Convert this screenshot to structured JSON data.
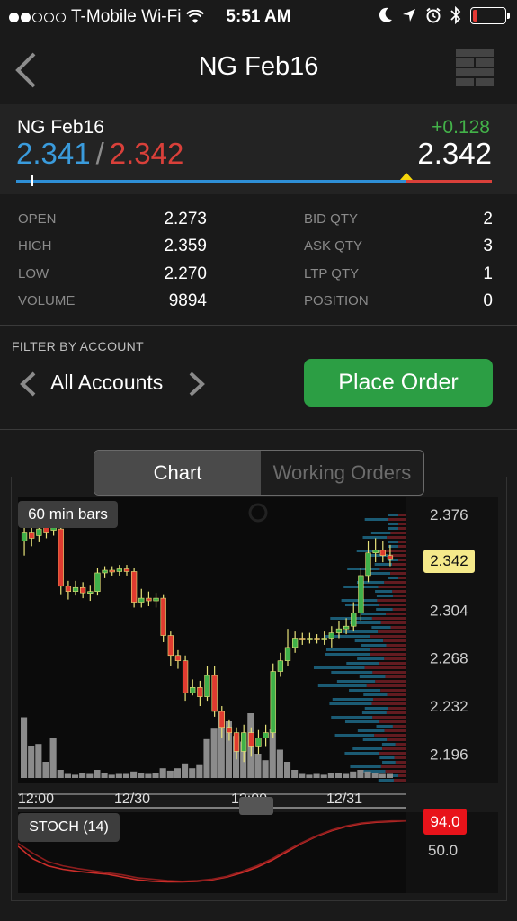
{
  "status_bar": {
    "carrier": "T-Mobile Wi-Fi",
    "time": "5:51 AM",
    "signal_dots_filled": 2,
    "signal_dots_total": 5,
    "battery_level": 0.15
  },
  "nav": {
    "title": "NG Feb16",
    "back_icon": "chevron-left-icon",
    "menu_icon": "grid-menu-icon"
  },
  "quote": {
    "symbol": "NG Feb16",
    "bid": "2.341",
    "separator": "/",
    "ask": "2.342",
    "change": "+0.128",
    "last": "2.342",
    "range_position": 0.82,
    "bid_color": "#3a9bdc",
    "ask_color": "#d9403a",
    "change_color": "#43b249"
  },
  "stats": {
    "left": [
      {
        "label": "OPEN",
        "value": "2.273"
      },
      {
        "label": "HIGH",
        "value": "2.359"
      },
      {
        "label": "LOW",
        "value": "2.270"
      },
      {
        "label": "VOLUME",
        "value": "9894"
      }
    ],
    "right": [
      {
        "label": "BID QTY",
        "value": "2"
      },
      {
        "label": "ASK QTY",
        "value": "3"
      },
      {
        "label": "LTP QTY",
        "value": "1"
      },
      {
        "label": "POSITION",
        "value": "0"
      }
    ]
  },
  "filter": {
    "label": "FILTER BY ACCOUNT",
    "account": "All Accounts",
    "place_order_label": "Place Order",
    "place_order_color": "#2c9e44"
  },
  "tabs": [
    {
      "label": "Chart",
      "active": true
    },
    {
      "label": "Working Orders",
      "active": false
    }
  ],
  "chart_data": {
    "type": "candlestick",
    "bars_label": "60 min bars",
    "y_ticks": [
      "2.376",
      "2.304",
      "2.268",
      "2.232",
      "2.196"
    ],
    "ylim": [
      2.178,
      2.386
    ],
    "current_price": "2.342",
    "x_ticks": [
      "12:00",
      "12/30",
      "12:00",
      "12/31"
    ],
    "candles": [
      {
        "o": 2.356,
        "c": 2.362,
        "h": 2.366,
        "l": 2.345
      },
      {
        "o": 2.362,
        "c": 2.358,
        "h": 2.368,
        "l": 2.352
      },
      {
        "o": 2.36,
        "c": 2.365,
        "h": 2.37,
        "l": 2.355
      },
      {
        "o": 2.366,
        "c": 2.362,
        "h": 2.371,
        "l": 2.358
      },
      {
        "o": 2.364,
        "c": 2.366,
        "h": 2.372,
        "l": 2.36
      },
      {
        "o": 2.365,
        "c": 2.322,
        "h": 2.368,
        "l": 2.316
      },
      {
        "o": 2.322,
        "c": 2.318,
        "h": 2.326,
        "l": 2.312
      },
      {
        "o": 2.318,
        "c": 2.321,
        "h": 2.326,
        "l": 2.315
      },
      {
        "o": 2.321,
        "c": 2.317,
        "h": 2.325,
        "l": 2.313
      },
      {
        "o": 2.317,
        "c": 2.318,
        "h": 2.323,
        "l": 2.311
      },
      {
        "o": 2.318,
        "c": 2.332,
        "h": 2.336,
        "l": 2.315
      },
      {
        "o": 2.332,
        "c": 2.334,
        "h": 2.337,
        "l": 2.328
      },
      {
        "o": 2.334,
        "c": 2.333,
        "h": 2.337,
        "l": 2.33
      },
      {
        "o": 2.333,
        "c": 2.335,
        "h": 2.338,
        "l": 2.33
      },
      {
        "o": 2.335,
        "c": 2.333,
        "h": 2.338,
        "l": 2.33
      },
      {
        "o": 2.333,
        "c": 2.31,
        "h": 2.336,
        "l": 2.306
      },
      {
        "o": 2.31,
        "c": 2.313,
        "h": 2.32,
        "l": 2.306
      },
      {
        "o": 2.313,
        "c": 2.311,
        "h": 2.318,
        "l": 2.307
      },
      {
        "o": 2.311,
        "c": 2.313,
        "h": 2.317,
        "l": 2.306
      },
      {
        "o": 2.313,
        "c": 2.285,
        "h": 2.316,
        "l": 2.28
      },
      {
        "o": 2.285,
        "c": 2.27,
        "h": 2.288,
        "l": 2.262
      },
      {
        "o": 2.27,
        "c": 2.266,
        "h": 2.274,
        "l": 2.26
      },
      {
        "o": 2.266,
        "c": 2.242,
        "h": 2.27,
        "l": 2.236
      },
      {
        "o": 2.242,
        "c": 2.246,
        "h": 2.252,
        "l": 2.24
      },
      {
        "o": 2.246,
        "c": 2.239,
        "h": 2.251,
        "l": 2.232
      },
      {
        "o": 2.239,
        "c": 2.255,
        "h": 2.262,
        "l": 2.236
      },
      {
        "o": 2.255,
        "c": 2.228,
        "h": 2.262,
        "l": 2.224
      },
      {
        "o": 2.228,
        "c": 2.216,
        "h": 2.232,
        "l": 2.208
      },
      {
        "o": 2.216,
        "c": 2.212,
        "h": 2.222,
        "l": 2.206
      },
      {
        "o": 2.212,
        "c": 2.198,
        "h": 2.216,
        "l": 2.192
      },
      {
        "o": 2.198,
        "c": 2.212,
        "h": 2.218,
        "l": 2.19
      },
      {
        "o": 2.212,
        "c": 2.202,
        "h": 2.216,
        "l": 2.194
      },
      {
        "o": 2.202,
        "c": 2.208,
        "h": 2.214,
        "l": 2.196
      },
      {
        "o": 2.208,
        "c": 2.212,
        "h": 2.218,
        "l": 2.202
      },
      {
        "o": 2.212,
        "c": 2.258,
        "h": 2.264,
        "l": 2.208
      },
      {
        "o": 2.258,
        "c": 2.266,
        "h": 2.272,
        "l": 2.254
      },
      {
        "o": 2.266,
        "c": 2.276,
        "h": 2.29,
        "l": 2.262
      },
      {
        "o": 2.276,
        "c": 2.283,
        "h": 2.288,
        "l": 2.272
      },
      {
        "o": 2.283,
        "c": 2.282,
        "h": 2.287,
        "l": 2.278
      },
      {
        "o": 2.282,
        "c": 2.283,
        "h": 2.287,
        "l": 2.279
      },
      {
        "o": 2.283,
        "c": 2.282,
        "h": 2.286,
        "l": 2.279
      },
      {
        "o": 2.282,
        "c": 2.283,
        "h": 2.288,
        "l": 2.278
      },
      {
        "o": 2.283,
        "c": 2.287,
        "h": 2.292,
        "l": 2.276
      },
      {
        "o": 2.287,
        "c": 2.29,
        "h": 2.296,
        "l": 2.283
      },
      {
        "o": 2.29,
        "c": 2.292,
        "h": 2.298,
        "l": 2.286
      },
      {
        "o": 2.292,
        "c": 2.302,
        "h": 2.31,
        "l": 2.288
      },
      {
        "o": 2.302,
        "c": 2.33,
        "h": 2.336,
        "l": 2.296
      },
      {
        "o": 2.33,
        "c": 2.347,
        "h": 2.356,
        "l": 2.325
      },
      {
        "o": 2.347,
        "c": 2.349,
        "h": 2.358,
        "l": 2.34
      },
      {
        "o": 2.349,
        "c": 2.345,
        "h": 2.356,
        "l": 2.34
      },
      {
        "o": 2.345,
        "c": 2.342,
        "h": 2.353,
        "l": 2.337
      }
    ],
    "volume": [
      0.75,
      0.4,
      0.42,
      0.2,
      0.5,
      0.1,
      0.05,
      0.04,
      0.06,
      0.05,
      0.1,
      0.06,
      0.04,
      0.05,
      0.05,
      0.08,
      0.06,
      0.05,
      0.06,
      0.12,
      0.09,
      0.12,
      0.18,
      0.12,
      0.17,
      0.48,
      0.62,
      0.82,
      0.7,
      0.52,
      0.45,
      0.8,
      0.3,
      0.22,
      0.6,
      0.35,
      0.2,
      0.1,
      0.05,
      0.04,
      0.05,
      0.04,
      0.06,
      0.06,
      0.05,
      0.08,
      0.1,
      0.08,
      0.06,
      0.05,
      0.05
    ],
    "volume_profile_colors": {
      "bid": "#1f6f8f",
      "ask": "#6b1d22"
    },
    "up_color": "#3fb049",
    "down_color": "#e03b30",
    "stoch": {
      "label": "STOCH (14)",
      "current": "94.0",
      "ticks": [
        "50.0"
      ],
      "k": [
        58,
        40,
        30,
        25,
        22,
        20,
        18,
        14,
        10,
        8,
        7,
        7,
        8,
        10,
        14,
        20,
        28,
        38,
        50,
        62,
        72,
        80,
        86,
        90,
        92,
        93,
        94
      ],
      "d": [
        62,
        48,
        36,
        30,
        26,
        23,
        20,
        17,
        13,
        11,
        9,
        8,
        9,
        11,
        15,
        22,
        30,
        40,
        52,
        63,
        73,
        81,
        87,
        91,
        93,
        94,
        94
      ]
    }
  }
}
